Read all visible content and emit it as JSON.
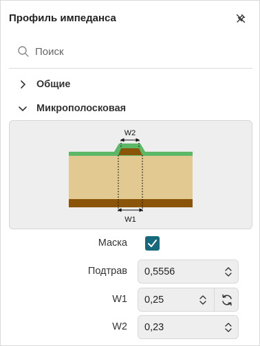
{
  "panel": {
    "title": "Профиль импеданса",
    "pin_icon": "pin-off-icon"
  },
  "search": {
    "placeholder": "Поиск",
    "value": ""
  },
  "sections": [
    {
      "label": "Общие",
      "expanded": false
    },
    {
      "label": "Микрополосковая",
      "expanded": true
    }
  ],
  "diagram": {
    "labels": {
      "top_width": "W2",
      "bottom_width": "W1"
    },
    "colors": {
      "background": "#eeeeee",
      "substrate": "#e2c992",
      "ground_copper": "#8a5508",
      "trace_copper": "#8a5508",
      "solder_mask": "#5cb866"
    }
  },
  "form": {
    "mask": {
      "label": "Маска",
      "checked": true,
      "accent": "#16687b"
    },
    "etch": {
      "label": "Подтрав",
      "value": "0,5556"
    },
    "w1": {
      "label": "W1",
      "value": "0,25"
    },
    "w2": {
      "label": "W2",
      "value": "0,23"
    }
  }
}
